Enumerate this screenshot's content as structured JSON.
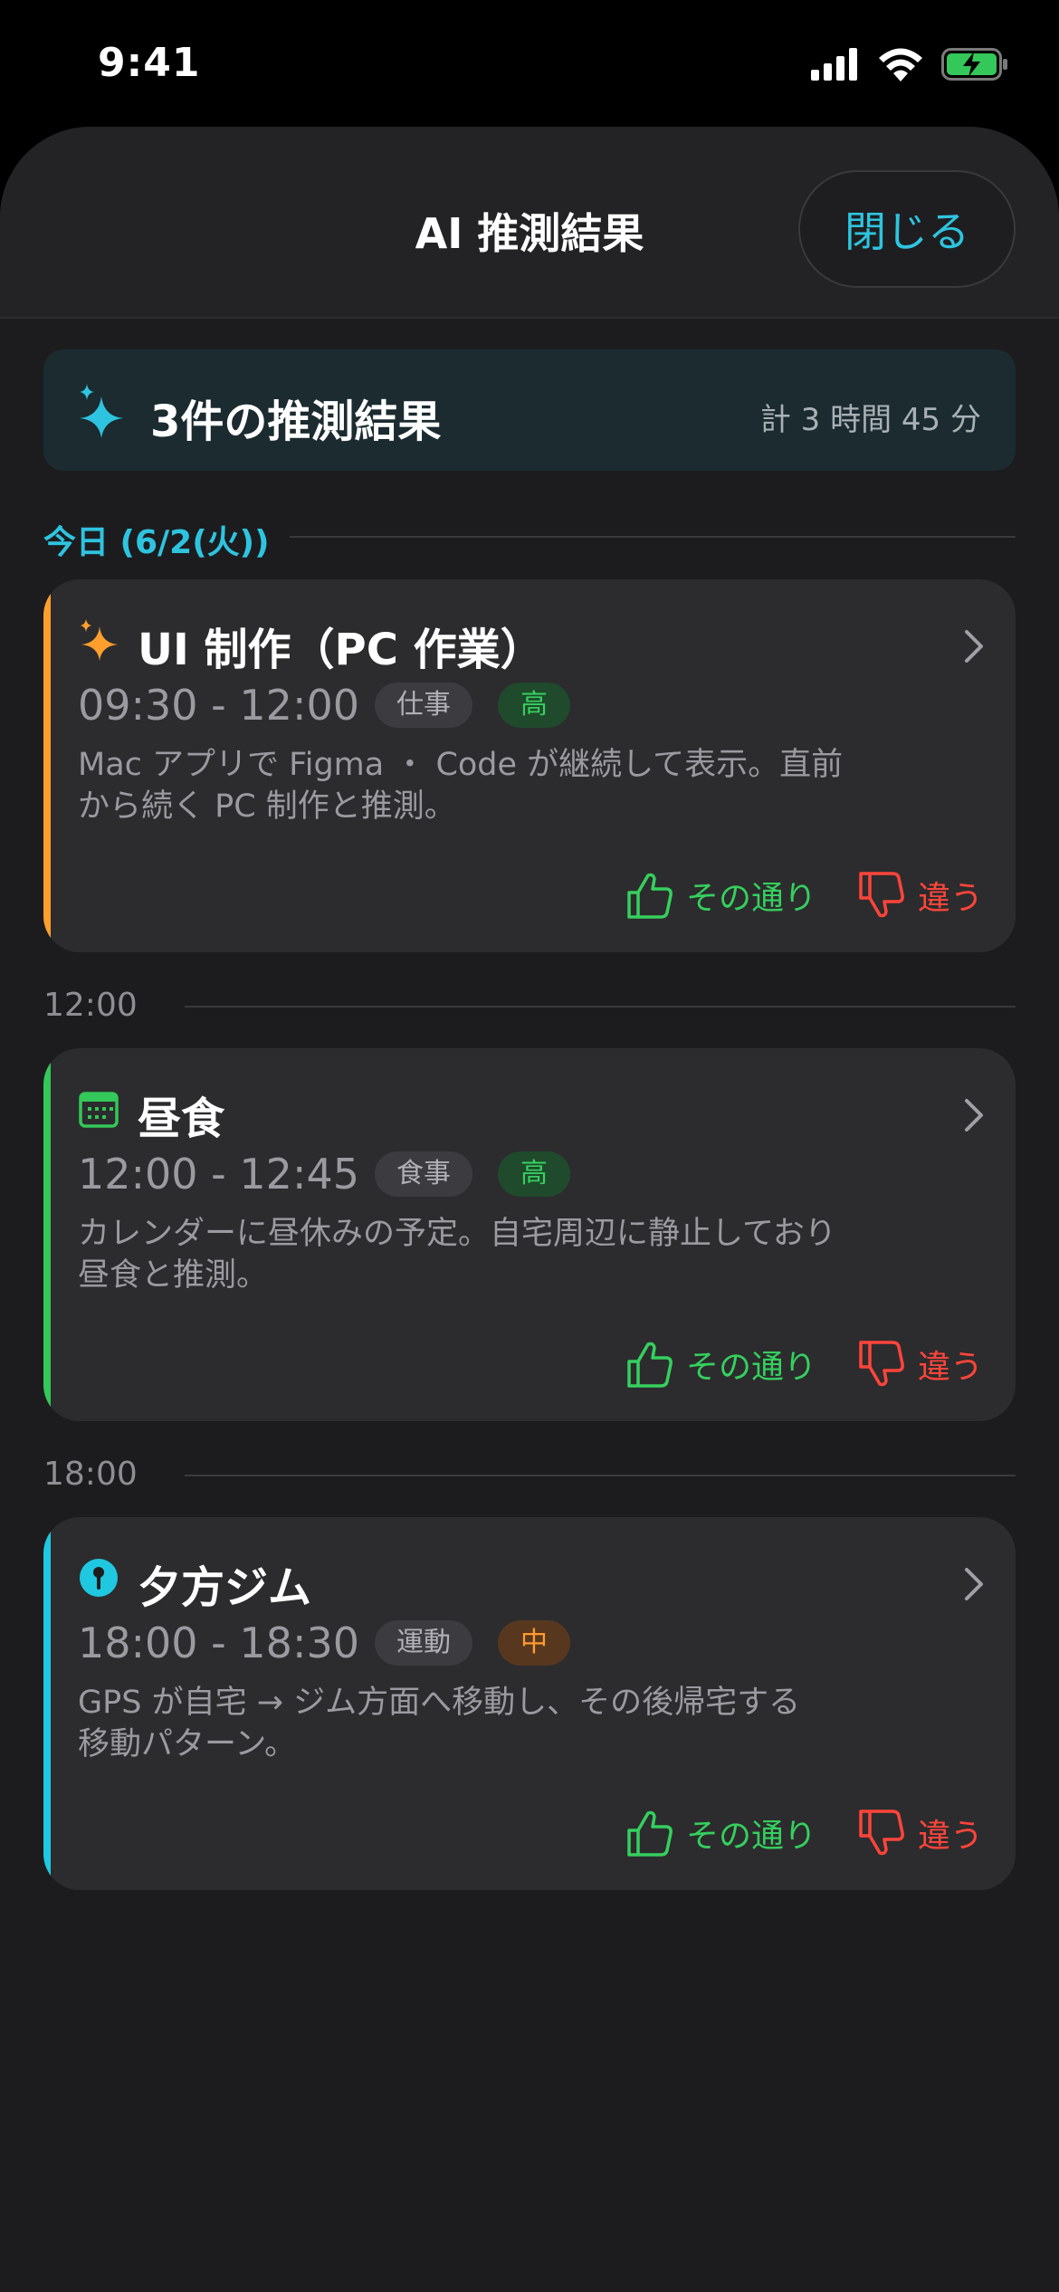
{
  "status_bar": {
    "time": "9:41"
  },
  "header": {
    "title": "AI 推測結果",
    "close_label": "閉じる"
  },
  "summary": {
    "title": "3件の推測結果",
    "total": "計 3 時間 45 分"
  },
  "sections": [
    {
      "label": "今日 (6/2(火))"
    },
    {
      "label": "12:00"
    },
    {
      "label": "18:00"
    }
  ],
  "cards": [
    {
      "icon": "sparkle-icon",
      "title": "UI 制作（PC 作業）",
      "time": "09:30 - 12:00",
      "category": "仕事",
      "confidence": "高",
      "desc_lines": [
        "Mac アプリで Figma ・ Code が継続して表示。直前",
        "から続く PC 制作と推測。"
      ],
      "accent": "#ff9f2e",
      "yes_label": "その通り",
      "no_label": "違う"
    },
    {
      "icon": "calendar-icon",
      "title": "昼食",
      "time": "12:00 - 12:45",
      "category": "食事",
      "confidence": "高",
      "desc_lines": [
        "カレンダーに昼休みの予定。自宅周辺に静止しており",
        "昼食と推測。"
      ],
      "accent": "#34c759",
      "yes_label": "その通り",
      "no_label": "違う"
    },
    {
      "icon": "location-pin-icon",
      "title": "夕方ジム",
      "time": "18:00 - 18:30",
      "category": "運動",
      "confidence": "中",
      "desc_lines": [
        "GPS が自宅 → ジム方面へ移動し、その後帰宅する",
        "移動パターン。"
      ],
      "accent": "#1fc8e0",
      "yes_label": "その通り",
      "no_label": "違う"
    }
  ],
  "colors": {
    "accent_cyan": "#2ec4e0",
    "positive": "#35d05e",
    "negative": "#ff453a",
    "mid": "#ff9a30"
  }
}
